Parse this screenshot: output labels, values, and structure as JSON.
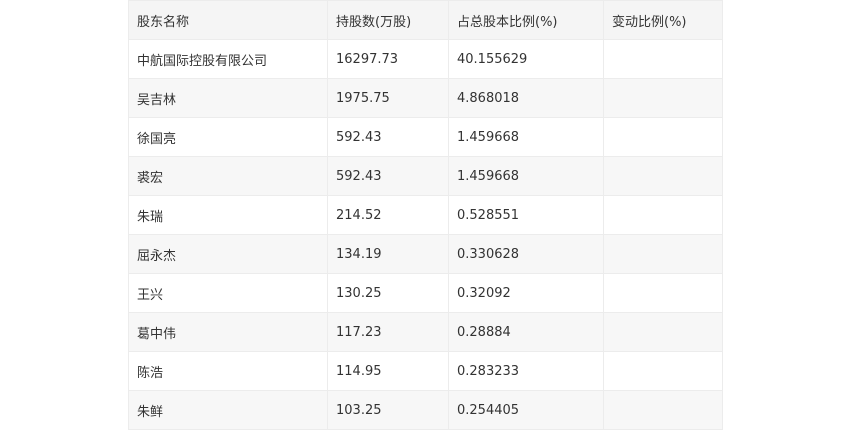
{
  "table": {
    "headers": [
      "股东名称",
      "持股数(万股)",
      "占总股本比例(%)",
      "变动比例(%)"
    ],
    "rows": [
      [
        "中航国际控股有限公司",
        "16297.73",
        "40.155629",
        ""
      ],
      [
        "吴吉林",
        "1975.75",
        "4.868018",
        ""
      ],
      [
        "徐国亮",
        "592.43",
        "1.459668",
        ""
      ],
      [
        "裘宏",
        "592.43",
        "1.459668",
        ""
      ],
      [
        "朱瑞",
        "214.52",
        "0.528551",
        ""
      ],
      [
        "屈永杰",
        "134.19",
        "0.330628",
        ""
      ],
      [
        "王兴",
        "130.25",
        "0.32092",
        ""
      ],
      [
        "葛中伟",
        "117.23",
        "0.28884",
        ""
      ],
      [
        "陈浩",
        "114.95",
        "0.283233",
        ""
      ],
      [
        "朱鲜",
        "103.25",
        "0.254405",
        ""
      ]
    ]
  }
}
